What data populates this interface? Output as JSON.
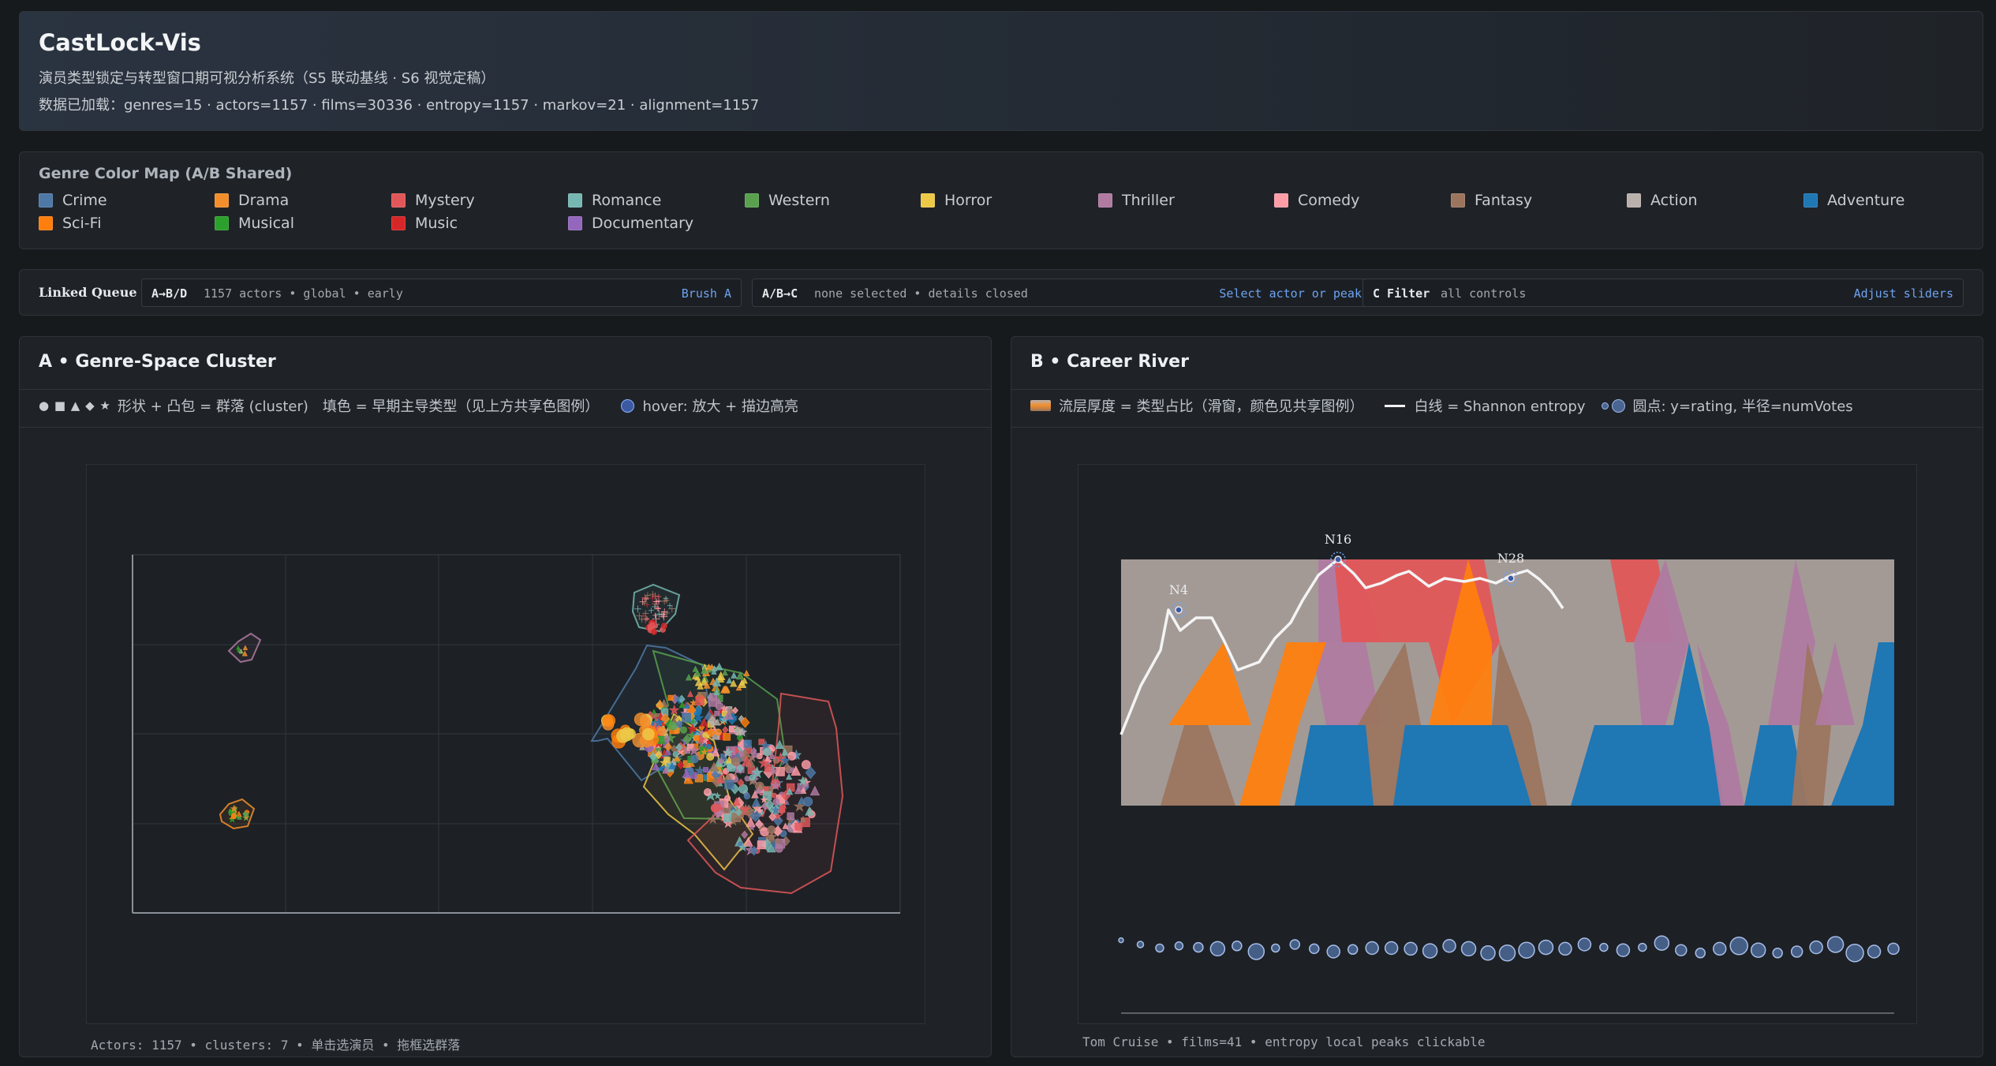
{
  "header": {
    "title": "CastLock-Vis",
    "subtitle": "演员类型锁定与转型窗口期可视分析系统（S5 联动基线 · S6 视觉定稿）",
    "status": "数据已加载：genres=15 · actors=1157 · films=30336 · entropy=1157 · markov=21 · alignment=1157"
  },
  "legend": {
    "title": "Genre Color Map (A/B Shared)",
    "genres": [
      {
        "name": "Crime",
        "color": "#4e79a7"
      },
      {
        "name": "Drama",
        "color": "#f28e2b"
      },
      {
        "name": "Mystery",
        "color": "#e15759"
      },
      {
        "name": "Romance",
        "color": "#76b7b2"
      },
      {
        "name": "Western",
        "color": "#59a14f"
      },
      {
        "name": "Horror",
        "color": "#edc948"
      },
      {
        "name": "Thriller",
        "color": "#b07aa1"
      },
      {
        "name": "Comedy",
        "color": "#ff9da7"
      },
      {
        "name": "Fantasy",
        "color": "#9c755f"
      },
      {
        "name": "Action",
        "color": "#bab0ac"
      },
      {
        "name": "Adventure",
        "color": "#1f77b4"
      },
      {
        "name": "Sci-Fi",
        "color": "#ff7f0e"
      },
      {
        "name": "Musical",
        "color": "#2ca02c"
      },
      {
        "name": "Music",
        "color": "#d62728"
      },
      {
        "name": "Documentary",
        "color": "#9467bd"
      }
    ]
  },
  "queue": {
    "title": "Linked Queue",
    "chips": [
      {
        "key": "A→B/D",
        "text": "1157 actors  •  global  •  early",
        "action": "Brush A"
      },
      {
        "key": "A/B→C",
        "text": "none selected  •  details closed",
        "action": "Select actor or peak"
      },
      {
        "key": "C Filter",
        "text": "all controls",
        "action": "Adjust sliders"
      }
    ]
  },
  "panel_a": {
    "title": "A • Genre-Space Cluster",
    "shape_glyphs": "● ■ ▲ ◆ ★",
    "shape_text": "形状 + 凸包 = 群落 (cluster)",
    "fill_text": "填色 = 早期主导类型（见上方共享色图例）",
    "hover_text": "hover: 放大 + 描边高亮",
    "footer": "Actors: 1157  •  clusters: 7  •  单击选演员  •  拖框选群落",
    "colors": {
      "hover_dot": "#3b5aa3"
    }
  },
  "panel_b": {
    "title": "B • Career River",
    "stream_text": "流层厚度 = 类型占比（滑窗，颜色见共享图例）",
    "entropy_text": "白线 = Shannon entropy",
    "dot_text": "圆点: y=rating, 半径=numVotes",
    "footer": "Tom Cruise  •  films=41  •  entropy local peaks clickable",
    "peaks": [
      "N4",
      "N16",
      "N28"
    ]
  }
}
